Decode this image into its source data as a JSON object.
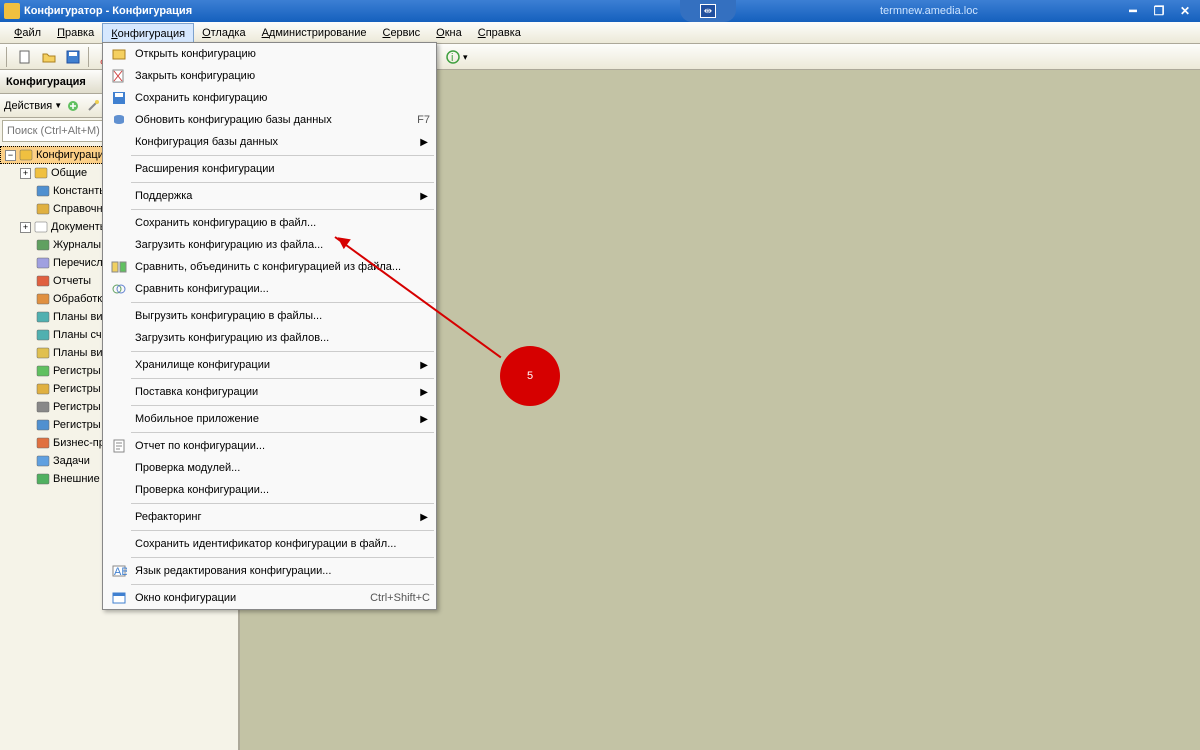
{
  "title": "Конфигуратор - Конфигурация",
  "hostname": "termnew.amedia.loc",
  "menubar": [
    "Файл",
    "Правка",
    "Конфигурация",
    "Отладка",
    "Администрирование",
    "Сервис",
    "Окна",
    "Справка"
  ],
  "menubar_active_index": 2,
  "sidebar": {
    "title": "Конфигурация",
    "actions_label": "Действия",
    "search_placeholder": "Поиск (Ctrl+Alt+M)",
    "tree": [
      {
        "label": "Конфигурация",
        "icon": "globe",
        "expandable": true,
        "expanded": true,
        "selected": true,
        "level": 0
      },
      {
        "label": "Общие",
        "icon": "cube-yellow",
        "expandable": true,
        "level": 1
      },
      {
        "label": "Константы",
        "icon": "table-blue",
        "level": 1
      },
      {
        "label": "Справочники",
        "icon": "book-yellow",
        "level": 1
      },
      {
        "label": "Документы",
        "icon": "doc",
        "expandable": true,
        "level": 1
      },
      {
        "label": "Журналы документов",
        "icon": "journal",
        "level": 1
      },
      {
        "label": "Перечисления",
        "icon": "list",
        "level": 1
      },
      {
        "label": "Отчеты",
        "icon": "report",
        "level": 1
      },
      {
        "label": "Обработки",
        "icon": "gear",
        "level": 1
      },
      {
        "label": "Планы видов характеристик",
        "icon": "plan-t",
        "level": 1
      },
      {
        "label": "Планы счетов",
        "icon": "plan-t2",
        "level": 1
      },
      {
        "label": "Планы видов расчета",
        "icon": "plan-calc",
        "level": 1
      },
      {
        "label": "Регистры сведений",
        "icon": "reg-info",
        "level": 1
      },
      {
        "label": "Регистры накопления",
        "icon": "reg-acc",
        "level": 1
      },
      {
        "label": "Регистры бухгалтерии",
        "icon": "reg-buh",
        "level": 1
      },
      {
        "label": "Регистры расчета",
        "icon": "reg-calc",
        "level": 1
      },
      {
        "label": "Бизнес-процессы",
        "icon": "bp",
        "level": 1
      },
      {
        "label": "Задачи",
        "icon": "task",
        "level": 1
      },
      {
        "label": "Внешние источники данных",
        "icon": "ext",
        "level": 1
      }
    ]
  },
  "dropdown": [
    {
      "label": "Открыть конфигурацию",
      "icon": "open"
    },
    {
      "label": "Закрыть конфигурацию",
      "icon": "close-cfg"
    },
    {
      "label": "Сохранить конфигурацию",
      "icon": "save"
    },
    {
      "label": "Обновить конфигурацию базы данных",
      "icon": "update",
      "shortcut": "F7"
    },
    {
      "label": "Конфигурация базы данных",
      "submenu": true
    },
    {
      "sep": true
    },
    {
      "label": "Расширения конфигурации"
    },
    {
      "sep": true
    },
    {
      "label": "Поддержка",
      "submenu": true
    },
    {
      "sep": true
    },
    {
      "label": "Сохранить конфигурацию в файл..."
    },
    {
      "label": "Загрузить конфигурацию из файла..."
    },
    {
      "label": "Сравнить, объединить с конфигурацией из файла...",
      "icon": "compare"
    },
    {
      "label": "Сравнить конфигурации...",
      "icon": "compare2"
    },
    {
      "sep": true
    },
    {
      "label": "Выгрузить конфигурацию в файлы..."
    },
    {
      "label": "Загрузить конфигурацию из файлов..."
    },
    {
      "sep": true
    },
    {
      "label": "Хранилище конфигурации",
      "submenu": true
    },
    {
      "sep": true
    },
    {
      "label": "Поставка конфигурации",
      "submenu": true
    },
    {
      "sep": true
    },
    {
      "label": "Мобильное приложение",
      "submenu": true
    },
    {
      "sep": true
    },
    {
      "label": "Отчет по конфигурации...",
      "icon": "report-cfg"
    },
    {
      "label": "Проверка модулей..."
    },
    {
      "label": "Проверка конфигурации..."
    },
    {
      "sep": true
    },
    {
      "label": "Рефакторинг",
      "submenu": true
    },
    {
      "sep": true
    },
    {
      "label": "Сохранить идентификатор конфигурации в файл..."
    },
    {
      "sep": true
    },
    {
      "label": "Язык редактирования конфигурации...",
      "icon": "lang"
    },
    {
      "sep": true
    },
    {
      "label": "Окно конфигурации",
      "icon": "window",
      "shortcut": "Ctrl+Shift+C"
    }
  ],
  "annotation": {
    "number": "5"
  }
}
